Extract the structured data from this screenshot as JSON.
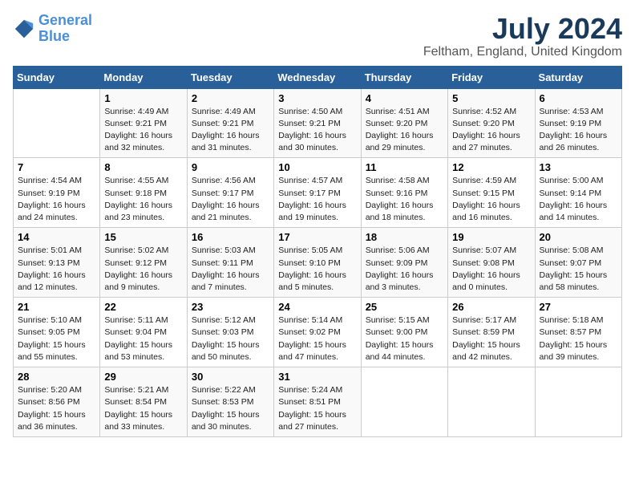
{
  "header": {
    "logo_line1": "General",
    "logo_line2": "Blue",
    "month": "July 2024",
    "location": "Feltham, England, United Kingdom"
  },
  "days_of_week": [
    "Sunday",
    "Monday",
    "Tuesday",
    "Wednesday",
    "Thursday",
    "Friday",
    "Saturday"
  ],
  "weeks": [
    [
      {
        "day": "",
        "data": ""
      },
      {
        "day": "1",
        "data": "Sunrise: 4:49 AM\nSunset: 9:21 PM\nDaylight: 16 hours\nand 32 minutes."
      },
      {
        "day": "2",
        "data": "Sunrise: 4:49 AM\nSunset: 9:21 PM\nDaylight: 16 hours\nand 31 minutes."
      },
      {
        "day": "3",
        "data": "Sunrise: 4:50 AM\nSunset: 9:21 PM\nDaylight: 16 hours\nand 30 minutes."
      },
      {
        "day": "4",
        "data": "Sunrise: 4:51 AM\nSunset: 9:20 PM\nDaylight: 16 hours\nand 29 minutes."
      },
      {
        "day": "5",
        "data": "Sunrise: 4:52 AM\nSunset: 9:20 PM\nDaylight: 16 hours\nand 27 minutes."
      },
      {
        "day": "6",
        "data": "Sunrise: 4:53 AM\nSunset: 9:19 PM\nDaylight: 16 hours\nand 26 minutes."
      }
    ],
    [
      {
        "day": "7",
        "data": "Sunrise: 4:54 AM\nSunset: 9:19 PM\nDaylight: 16 hours\nand 24 minutes."
      },
      {
        "day": "8",
        "data": "Sunrise: 4:55 AM\nSunset: 9:18 PM\nDaylight: 16 hours\nand 23 minutes."
      },
      {
        "day": "9",
        "data": "Sunrise: 4:56 AM\nSunset: 9:17 PM\nDaylight: 16 hours\nand 21 minutes."
      },
      {
        "day": "10",
        "data": "Sunrise: 4:57 AM\nSunset: 9:17 PM\nDaylight: 16 hours\nand 19 minutes."
      },
      {
        "day": "11",
        "data": "Sunrise: 4:58 AM\nSunset: 9:16 PM\nDaylight: 16 hours\nand 18 minutes."
      },
      {
        "day": "12",
        "data": "Sunrise: 4:59 AM\nSunset: 9:15 PM\nDaylight: 16 hours\nand 16 minutes."
      },
      {
        "day": "13",
        "data": "Sunrise: 5:00 AM\nSunset: 9:14 PM\nDaylight: 16 hours\nand 14 minutes."
      }
    ],
    [
      {
        "day": "14",
        "data": "Sunrise: 5:01 AM\nSunset: 9:13 PM\nDaylight: 16 hours\nand 12 minutes."
      },
      {
        "day": "15",
        "data": "Sunrise: 5:02 AM\nSunset: 9:12 PM\nDaylight: 16 hours\nand 9 minutes."
      },
      {
        "day": "16",
        "data": "Sunrise: 5:03 AM\nSunset: 9:11 PM\nDaylight: 16 hours\nand 7 minutes."
      },
      {
        "day": "17",
        "data": "Sunrise: 5:05 AM\nSunset: 9:10 PM\nDaylight: 16 hours\nand 5 minutes."
      },
      {
        "day": "18",
        "data": "Sunrise: 5:06 AM\nSunset: 9:09 PM\nDaylight: 16 hours\nand 3 minutes."
      },
      {
        "day": "19",
        "data": "Sunrise: 5:07 AM\nSunset: 9:08 PM\nDaylight: 16 hours\nand 0 minutes."
      },
      {
        "day": "20",
        "data": "Sunrise: 5:08 AM\nSunset: 9:07 PM\nDaylight: 15 hours\nand 58 minutes."
      }
    ],
    [
      {
        "day": "21",
        "data": "Sunrise: 5:10 AM\nSunset: 9:05 PM\nDaylight: 15 hours\nand 55 minutes."
      },
      {
        "day": "22",
        "data": "Sunrise: 5:11 AM\nSunset: 9:04 PM\nDaylight: 15 hours\nand 53 minutes."
      },
      {
        "day": "23",
        "data": "Sunrise: 5:12 AM\nSunset: 9:03 PM\nDaylight: 15 hours\nand 50 minutes."
      },
      {
        "day": "24",
        "data": "Sunrise: 5:14 AM\nSunset: 9:02 PM\nDaylight: 15 hours\nand 47 minutes."
      },
      {
        "day": "25",
        "data": "Sunrise: 5:15 AM\nSunset: 9:00 PM\nDaylight: 15 hours\nand 44 minutes."
      },
      {
        "day": "26",
        "data": "Sunrise: 5:17 AM\nSunset: 8:59 PM\nDaylight: 15 hours\nand 42 minutes."
      },
      {
        "day": "27",
        "data": "Sunrise: 5:18 AM\nSunset: 8:57 PM\nDaylight: 15 hours\nand 39 minutes."
      }
    ],
    [
      {
        "day": "28",
        "data": "Sunrise: 5:20 AM\nSunset: 8:56 PM\nDaylight: 15 hours\nand 36 minutes."
      },
      {
        "day": "29",
        "data": "Sunrise: 5:21 AM\nSunset: 8:54 PM\nDaylight: 15 hours\nand 33 minutes."
      },
      {
        "day": "30",
        "data": "Sunrise: 5:22 AM\nSunset: 8:53 PM\nDaylight: 15 hours\nand 30 minutes."
      },
      {
        "day": "31",
        "data": "Sunrise: 5:24 AM\nSunset: 8:51 PM\nDaylight: 15 hours\nand 27 minutes."
      },
      {
        "day": "",
        "data": ""
      },
      {
        "day": "",
        "data": ""
      },
      {
        "day": "",
        "data": ""
      }
    ]
  ]
}
